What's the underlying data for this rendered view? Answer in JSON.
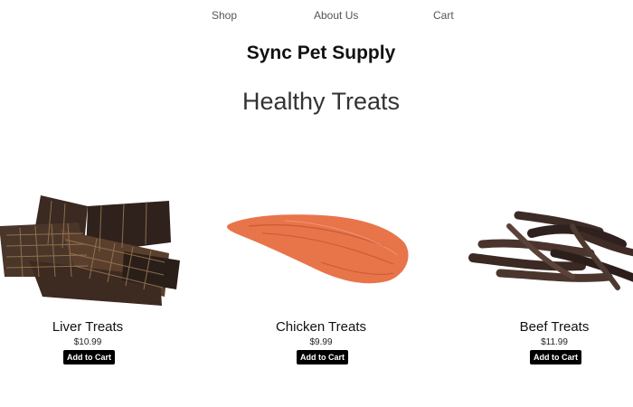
{
  "nav": {
    "shop": "Shop",
    "about": "About Us",
    "cart": "Cart"
  },
  "header": {
    "brand": "Sync Pet Supply",
    "section_title": "Healthy Treats"
  },
  "products": [
    {
      "name": "Liver Treats",
      "price": "$10.99",
      "button": "Add to Cart",
      "image": "liver-treats-image"
    },
    {
      "name": "Chicken Treats",
      "price": "$9.99",
      "button": "Add to Cart",
      "image": "chicken-treats-image"
    },
    {
      "name": "Beef Treats",
      "price": "$11.99",
      "button": "Add to Cart",
      "image": "beef-treats-image"
    }
  ],
  "colors": {
    "button_bg": "#000000",
    "button_text": "#ffffff",
    "liver": "#3b2a22",
    "chicken": "#e8744a",
    "beef": "#3d2b26"
  }
}
